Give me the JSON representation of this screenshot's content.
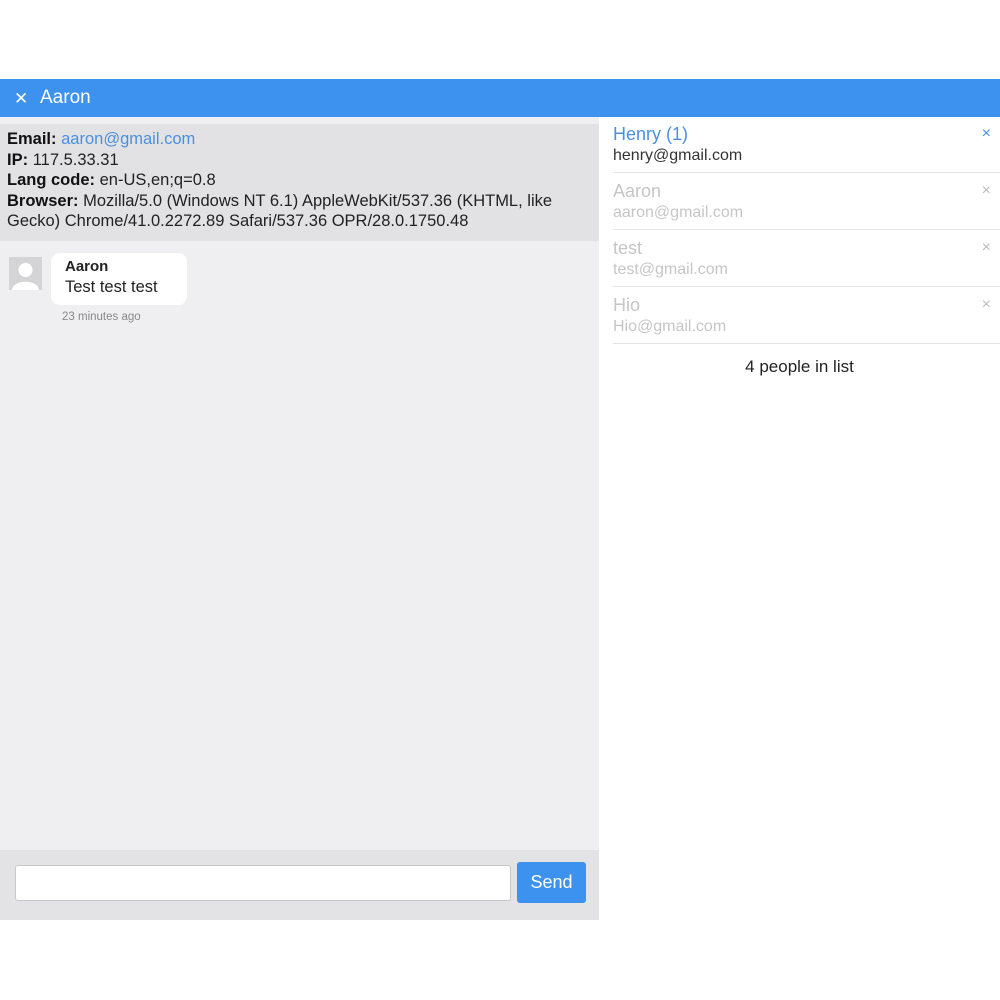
{
  "window": {
    "title": "Aaron",
    "close_glyph": "✕"
  },
  "visitor_info": {
    "email_label": "Email:",
    "email": "aaron@gmail.com",
    "ip_label": "IP:",
    "ip": "117.5.33.31",
    "lang_label": "Lang code:",
    "lang": "en-US,en;q=0.8",
    "browser_label": "Browser:",
    "browser": "Mozilla/5.0 (Windows NT 6.1) AppleWebKit/537.36 (KHTML, like Gecko) Chrome/41.0.2272.89 Safari/537.36 OPR/28.0.1750.48"
  },
  "messages": [
    {
      "author": "Aaron",
      "text": "Test test test",
      "time": "23 minutes ago",
      "avatar_icon": "user-avatar-icon"
    }
  ],
  "composer": {
    "input_value": "",
    "input_placeholder": "",
    "send_label": "Send"
  },
  "people": {
    "items": [
      {
        "name": "Henry (1)",
        "email": "henry@gmail.com",
        "state": "active",
        "remove_glyph": "×"
      },
      {
        "name": "Aaron",
        "email": "aaron@gmail.com",
        "state": "inactive",
        "remove_glyph": "×"
      },
      {
        "name": "test",
        "email": "test@gmail.com",
        "state": "inactive",
        "remove_glyph": "×"
      },
      {
        "name": "Hio",
        "email": "Hio@gmail.com",
        "state": "inactive",
        "remove_glyph": "×"
      }
    ],
    "count_text": "4 people in list"
  },
  "colors": {
    "accent": "#3c92ee",
    "link": "#4a90e2",
    "chat_background": "#efeff1",
    "info_background": "#e2e2e4",
    "inactive_text": "#c6c6c6"
  }
}
